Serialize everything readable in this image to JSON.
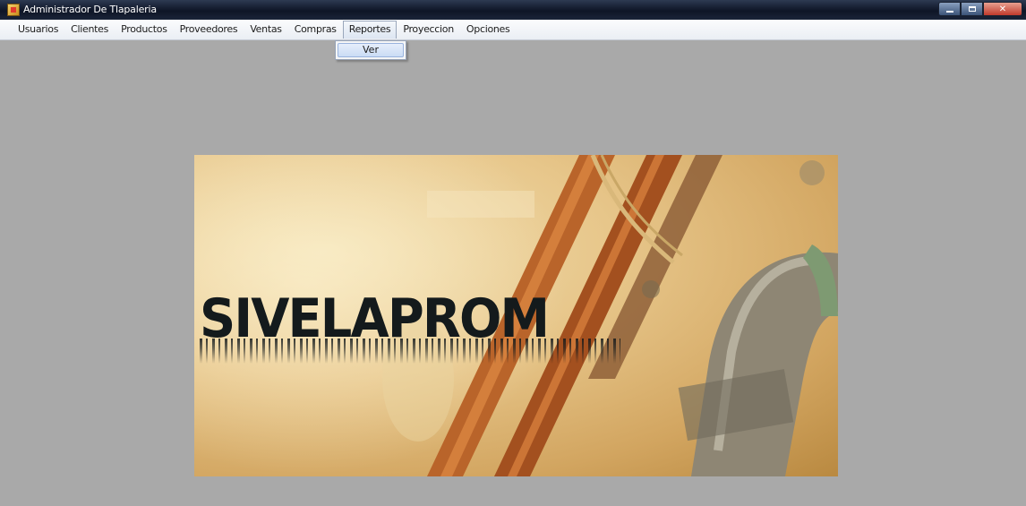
{
  "window": {
    "title": "Administrador De Tlapaleria",
    "icon": "app-icon",
    "controls": [
      "minimize-icon",
      "maximize-icon",
      "close-icon"
    ]
  },
  "menu": {
    "items": [
      {
        "label": "Usuarios"
      },
      {
        "label": "Clientes"
      },
      {
        "label": "Productos"
      },
      {
        "label": "Proveedores"
      },
      {
        "label": "Ventas"
      },
      {
        "label": "Compras"
      },
      {
        "label": "Reportes",
        "active": true
      },
      {
        "label": "Proyeccion"
      },
      {
        "label": "Opciones"
      }
    ],
    "open_dropdown": {
      "parent": "Reportes",
      "items": [
        {
          "label": "Ver"
        }
      ]
    }
  },
  "banner": {
    "logo_text": "SIVELAPROM"
  },
  "colors": {
    "workspace": "#a9a9a9",
    "titlebar": "#0e1526",
    "menubar": "#eaeef4",
    "highlight": "#cadcf5"
  }
}
